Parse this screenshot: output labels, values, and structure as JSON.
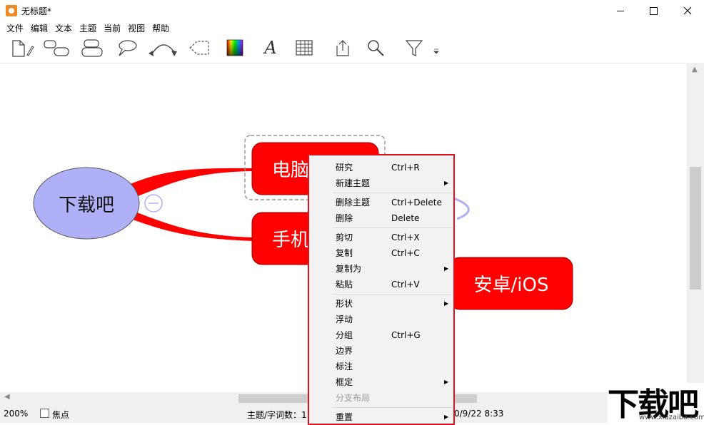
{
  "window": {
    "title": "无标题*",
    "minimize_symbol": "—",
    "maximize_symbol": "☐",
    "close_symbol": "✕"
  },
  "menubar": {
    "items": [
      "文件",
      "编辑",
      "文本",
      "主题",
      "当前",
      "视图",
      "帮助"
    ]
  },
  "toolbar": {
    "tools": [
      "new-document-icon",
      "topic-icon",
      "subtopic-icon",
      "callout-icon",
      "relationship-icon",
      "boundary-icon",
      "color-palette-icon",
      "font-icon",
      "table-icon",
      "export-icon",
      "search-icon",
      "filter-icon",
      "more-icon"
    ],
    "font_glyph": "A"
  },
  "mindmap": {
    "central_topic": "下载吧",
    "topics": [
      "电脑",
      "手机",
      "安卓/iOS"
    ],
    "colors": {
      "central_fill": "#b0b0f8",
      "topic_fill": "#ff0000",
      "branch": "#ff0000",
      "relationship": "#b0b0f8"
    }
  },
  "context_menu": {
    "groups": [
      [
        {
          "label": "研究",
          "shortcut": "Ctrl+R"
        },
        {
          "label": "新建主题",
          "submenu": true
        }
      ],
      [
        {
          "label": "删除主题",
          "shortcut": "Ctrl+Delete"
        },
        {
          "label": "删除",
          "shortcut": "Delete"
        }
      ],
      [
        {
          "label": "剪切",
          "shortcut": "Ctrl+X"
        },
        {
          "label": "复制",
          "shortcut": "Ctrl+C"
        },
        {
          "label": "复制为",
          "submenu": true
        },
        {
          "label": "粘贴",
          "shortcut": "Ctrl+V"
        }
      ],
      [
        {
          "label": "形状",
          "submenu": true
        },
        {
          "label": "浮动"
        },
        {
          "label": "分组",
          "shortcut": "Ctrl+G"
        },
        {
          "label": "边界"
        },
        {
          "label": "标注"
        },
        {
          "label": "框定",
          "submenu": true
        },
        {
          "label": "分支布局",
          "disabled": true
        }
      ],
      [
        {
          "label": "重置",
          "submenu": true
        }
      ]
    ],
    "submenu_arrow": "▶",
    "border_color": "#e0141e"
  },
  "statusbar": {
    "zoom": "200%",
    "focus_label": "焦点",
    "focus_checked": false,
    "word_count": "主题/字词数：1",
    "timestamp": "0/9/22 8:33"
  },
  "watermark": {
    "text": "下载吧",
    "url": "www.xiazaiba.com"
  }
}
